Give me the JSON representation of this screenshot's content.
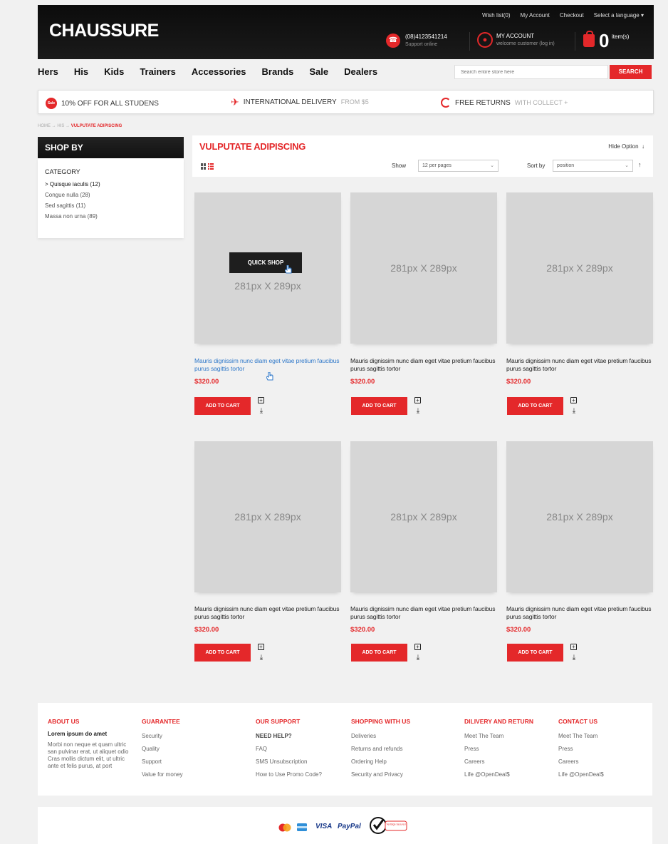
{
  "header": {
    "logo": "CHAUSSURE",
    "top_links": [
      "Wish list(0)",
      "My Account",
      "Checkout",
      "Select a language"
    ],
    "phone": "(08)4123541214",
    "phone_sub": "Support online",
    "account": "MY ACCOUNT",
    "account_sub": "welcome customer (log in)",
    "cart_count": "0",
    "cart_label": "item(s)"
  },
  "nav": [
    "Hers",
    "His",
    "Kids",
    "Trainers",
    "Accessories",
    "Brands",
    "Sale",
    "Dealers"
  ],
  "search": {
    "placeholder": "Search entire store here",
    "button": "SEARCH"
  },
  "promo": {
    "sale_badge": "Sale",
    "item1": "10% OFF FOR ALL STUDENS",
    "item2": "INTERNATIONAL DELIVERY",
    "item2_dim": "FROM $5",
    "item3": "FREE RETURNS",
    "item3_dim": "WITH COLLECT +"
  },
  "breadcrumb": {
    "home": "HOME",
    "his": "HIS",
    "current": "VULPUTATE ADIPISCING",
    "sep": "→"
  },
  "sidebar": {
    "title": "SHOP BY",
    "category_title": "CATEGORY",
    "items": [
      "Quisque iaculis (12)",
      "Congue nulla (28)",
      "Sed sagittis (11)",
      "Massa non urna (89)"
    ]
  },
  "main": {
    "title": "VULPUTATE ADIPISCING",
    "hide_option": "Hide Option",
    "show_label": "Show",
    "show_value": "12 per pages",
    "sort_label": "Sort by",
    "sort_value": "position"
  },
  "products": [
    {
      "image_text": "281px X 289px",
      "name": "Mauris dignissim nunc diam eget vitae pretium faucibus purus sagittis tortor",
      "price": "$320.00",
      "button": "ADD TO CART"
    },
    {
      "image_text": "281px X 289px",
      "name": "Mauris dignissim nunc diam eget vitae pretium faucibus purus sagittis tortor",
      "price": "$320.00",
      "button": "ADD TO CART"
    },
    {
      "image_text": "281px X 289px",
      "name": "Mauris dignissim nunc diam eget vitae pretium faucibus purus sagittis tortor",
      "price": "$320.00",
      "button": "ADD TO CART"
    },
    {
      "image_text": "281px X 289px",
      "name": "Mauris dignissim nunc diam eget vitae pretium faucibus purus sagittis tortor",
      "price": "$320.00",
      "button": "ADD TO CART"
    },
    {
      "image_text": "281px X 289px",
      "name": "Mauris dignissim nunc diam eget vitae pretium faucibus purus sagittis tortor",
      "price": "$320.00",
      "button": "ADD TO CART"
    },
    {
      "image_text": "281px X 289px",
      "name": "Mauris dignissim nunc diam eget vitae pretium faucibus purus sagittis tortor",
      "price": "$320.00",
      "button": "ADD TO CART"
    }
  ],
  "quick_shop": "QUICK SHOP",
  "footer": {
    "about": {
      "title": "ABOUT US",
      "bold": "Lorem ipsum do amet",
      "text": "Morbi non neque et quam ultric san pulvinar erat, ut aliquet odio Cras mollis dictum elit, ut ultric ante et felis purus, at port"
    },
    "guarantee": {
      "title": "GUARANTEE",
      "items": [
        "Security",
        "Quality",
        "Support",
        "Value for money"
      ]
    },
    "support": {
      "title": "OUR SUPPORT",
      "bold": "NEED HELP?",
      "items": [
        "FAQ",
        "SMS Unsubscription",
        "How to Use Promo Code?"
      ]
    },
    "shopping": {
      "title": "SHOPPING WITH US",
      "items": [
        "Deliveries",
        "Returns and refunds",
        "Ordering Help",
        "Security and Privacy"
      ]
    },
    "delivery": {
      "title": "DILIVERY AND RETURN",
      "items": [
        "Meet The Team",
        "Press",
        "Careers",
        "Life @OpenDeal$"
      ]
    },
    "contact": {
      "title": "CONTACT US",
      "items": [
        "Meet The Team",
        "Press",
        "Careers",
        "Life @OpenDeal$"
      ]
    }
  },
  "payments": {
    "visa": "VISA",
    "paypal": "PayPal",
    "verisign": "VeriSign Secured"
  },
  "colors": {
    "accent": "#e4282a",
    "dark": "#111111",
    "link": "#2f78c9"
  }
}
